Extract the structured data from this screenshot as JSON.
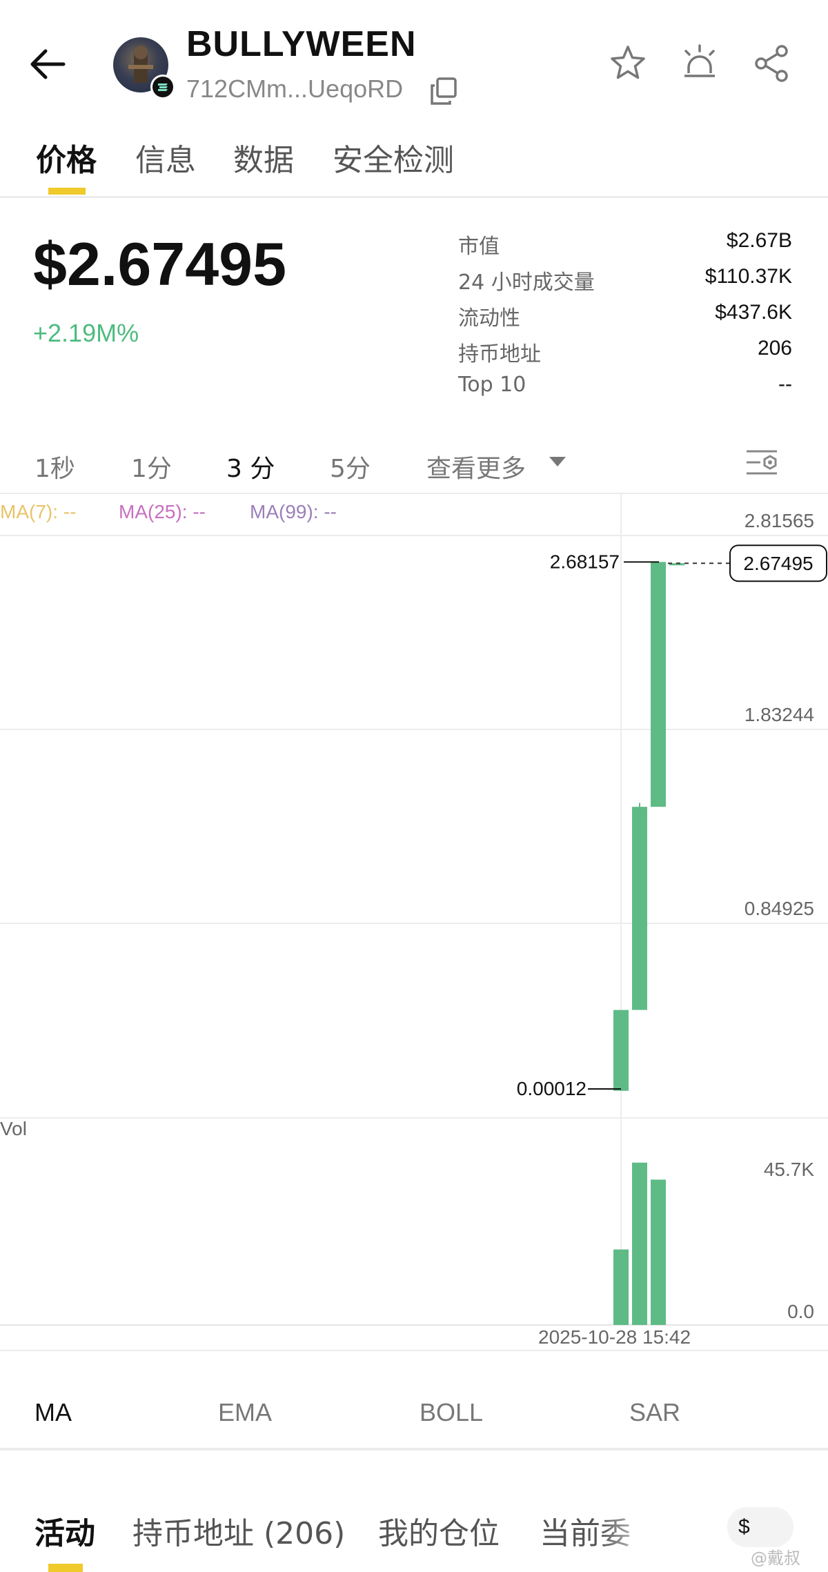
{
  "header": {
    "token_name": "BULLYWEEN",
    "token_address": "712CMm...UeqoRD",
    "icons": [
      "back-arrow-icon",
      "copy-icon",
      "star-icon",
      "alert-icon",
      "share-icon"
    ]
  },
  "tabs": [
    {
      "label": "价格",
      "active": true
    },
    {
      "label": "信息",
      "active": false
    },
    {
      "label": "数据",
      "active": false
    },
    {
      "label": "安全检测",
      "active": false
    }
  ],
  "price": {
    "value": "$2.67495",
    "change": "+2.19M%"
  },
  "stats": [
    {
      "label": "市值",
      "value": "$2.67B"
    },
    {
      "label": "24 小时成交量",
      "value": "$110.37K"
    },
    {
      "label": "流动性",
      "value": "$437.6K"
    },
    {
      "label": "持币地址",
      "value": "206"
    },
    {
      "label": "Top 10",
      "value": "--"
    }
  ],
  "intervals": [
    {
      "label": "1秒",
      "active": false
    },
    {
      "label": "1分",
      "active": false
    },
    {
      "label": "3 分",
      "active": true
    },
    {
      "label": "5分",
      "active": false
    },
    {
      "label": "查看更多",
      "active": false
    }
  ],
  "ma_labels": [
    {
      "text": "MA(7): --",
      "color": "#e8c36a"
    },
    {
      "text": "MA(25): --",
      "color": "#c86fc1"
    },
    {
      "text": "MA(99): --",
      "color": "#9b7fb8"
    }
  ],
  "chart_data": {
    "type": "candlestick",
    "price_axis_ticks": [
      "2.81565",
      "1.83244",
      "0.84925"
    ],
    "high_label": "2.68157",
    "low_label": "0.00012",
    "current_price_label": "2.67495",
    "candles": [
      {
        "open": 0.00012,
        "close": 0.41,
        "high": 0.41,
        "low": 0.00012
      },
      {
        "open": 0.41,
        "close": 1.44,
        "high": 1.46,
        "low": 0.41
      },
      {
        "open": 1.44,
        "close": 2.68157,
        "high": 2.68157,
        "low": 1.44
      },
      {
        "open": 2.672,
        "close": 2.67495,
        "high": 2.678,
        "low": 2.67
      }
    ],
    "volume_label": "Vol",
    "volume_axis_ticks": [
      "45.7K",
      "0.0"
    ],
    "volumes": [
      20000,
      43000,
      38500,
      0
    ],
    "volume_max": 45700,
    "time_label": "2025-10-28 15:42",
    "up_color": "#5ebb86"
  },
  "indicators": [
    {
      "label": "MA",
      "active": true
    },
    {
      "label": "EMA",
      "active": false
    },
    {
      "label": "BOLL",
      "active": false
    },
    {
      "label": "SAR",
      "active": false
    }
  ],
  "bottom_tabs": [
    {
      "label": "活动",
      "active": true
    },
    {
      "label": "持币地址 (206)",
      "active": false
    },
    {
      "label": "我的仓位",
      "active": false
    },
    {
      "label": "当前委",
      "active": false
    }
  ],
  "currency_button": "$",
  "watermark": "@戴叔"
}
